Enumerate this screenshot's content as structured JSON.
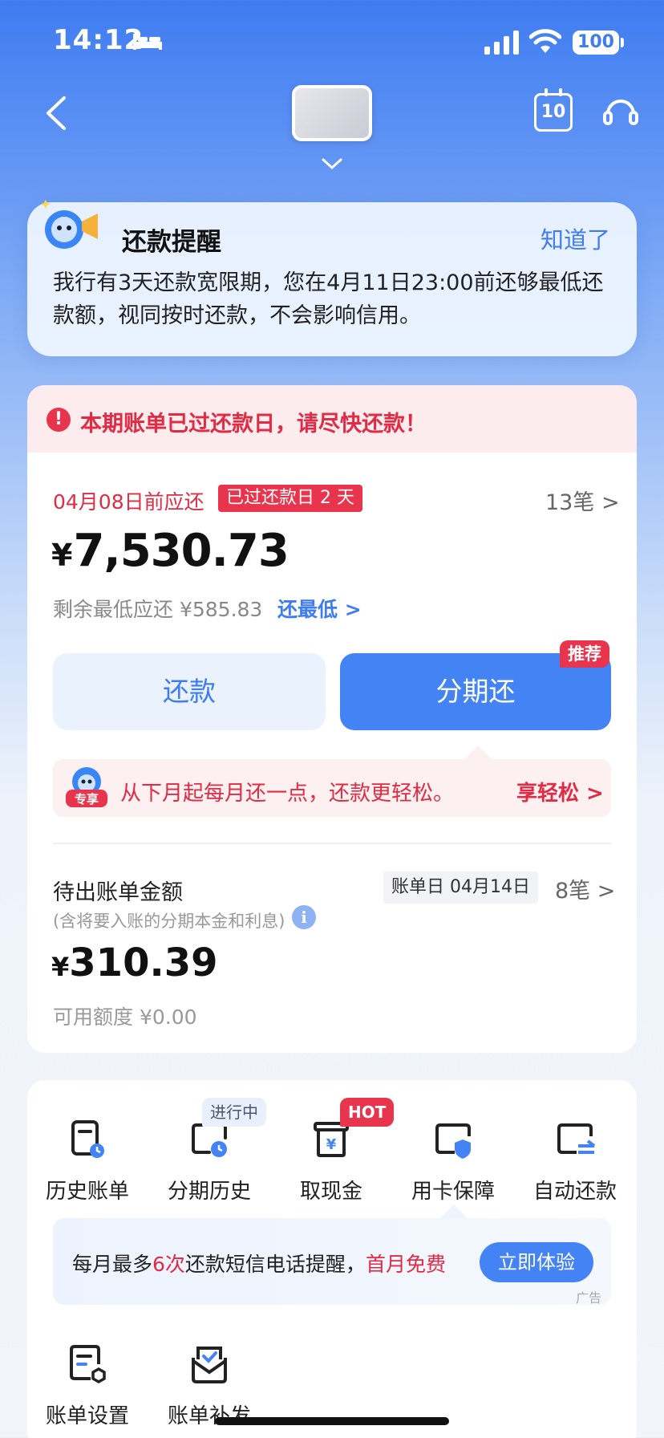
{
  "status_bar": {
    "time": "14:12",
    "battery": "100"
  },
  "nav": {
    "calendar_day": "10"
  },
  "reminder": {
    "title": "还款提醒",
    "dismiss": "知道了",
    "body": "我行有3天还款宽限期，您在4月11日23:00前还够最低还款额，视同按时还款，不会影响信用。"
  },
  "bill": {
    "overdue_notice": "本期账单已过还款日，请尽快还款！",
    "due_label": "04月08日前应还",
    "overdue_days_tag": "已过还款日 2 天",
    "transactions": "13笔 >",
    "currency": "¥",
    "amount": "7,530.73",
    "min_remaining": "剩余最低应还 ¥585.83",
    "pay_min_link": "还最低 >",
    "repay_button": "还款",
    "installment_button": "分期还",
    "recommend_tag": "推荐",
    "promo_badge": "专享",
    "promo_text": "从下月起每月还一点，还款更轻松。",
    "promo_link": "享轻松 >"
  },
  "pending": {
    "label": "待出账单金额",
    "note": "(含将要入账的分期本金和利息)",
    "bill_day": "账单日 04月14日",
    "transactions": "8笔 >",
    "currency": "¥",
    "amount": "310.39",
    "available_credit": "可用额度 ¥0.00"
  },
  "functions": {
    "items": [
      {
        "label": "历史账单"
      },
      {
        "label": "分期历史",
        "tag": "进行中"
      },
      {
        "label": "取现金",
        "tag": "HOT"
      },
      {
        "label": "用卡保障"
      },
      {
        "label": "自动还款"
      },
      {
        "label": "账单设置"
      },
      {
        "label": "账单补发"
      }
    ]
  },
  "ad": {
    "text_1": "每月最多",
    "text_highlight_1": "6次",
    "text_2": "还款短信电话提醒，",
    "text_highlight_2": "首月免费",
    "button": "立即体验",
    "label": "广告"
  },
  "colors": {
    "primary": "#4383f3",
    "danger": "#e02b45",
    "link": "#3e7cf0"
  }
}
